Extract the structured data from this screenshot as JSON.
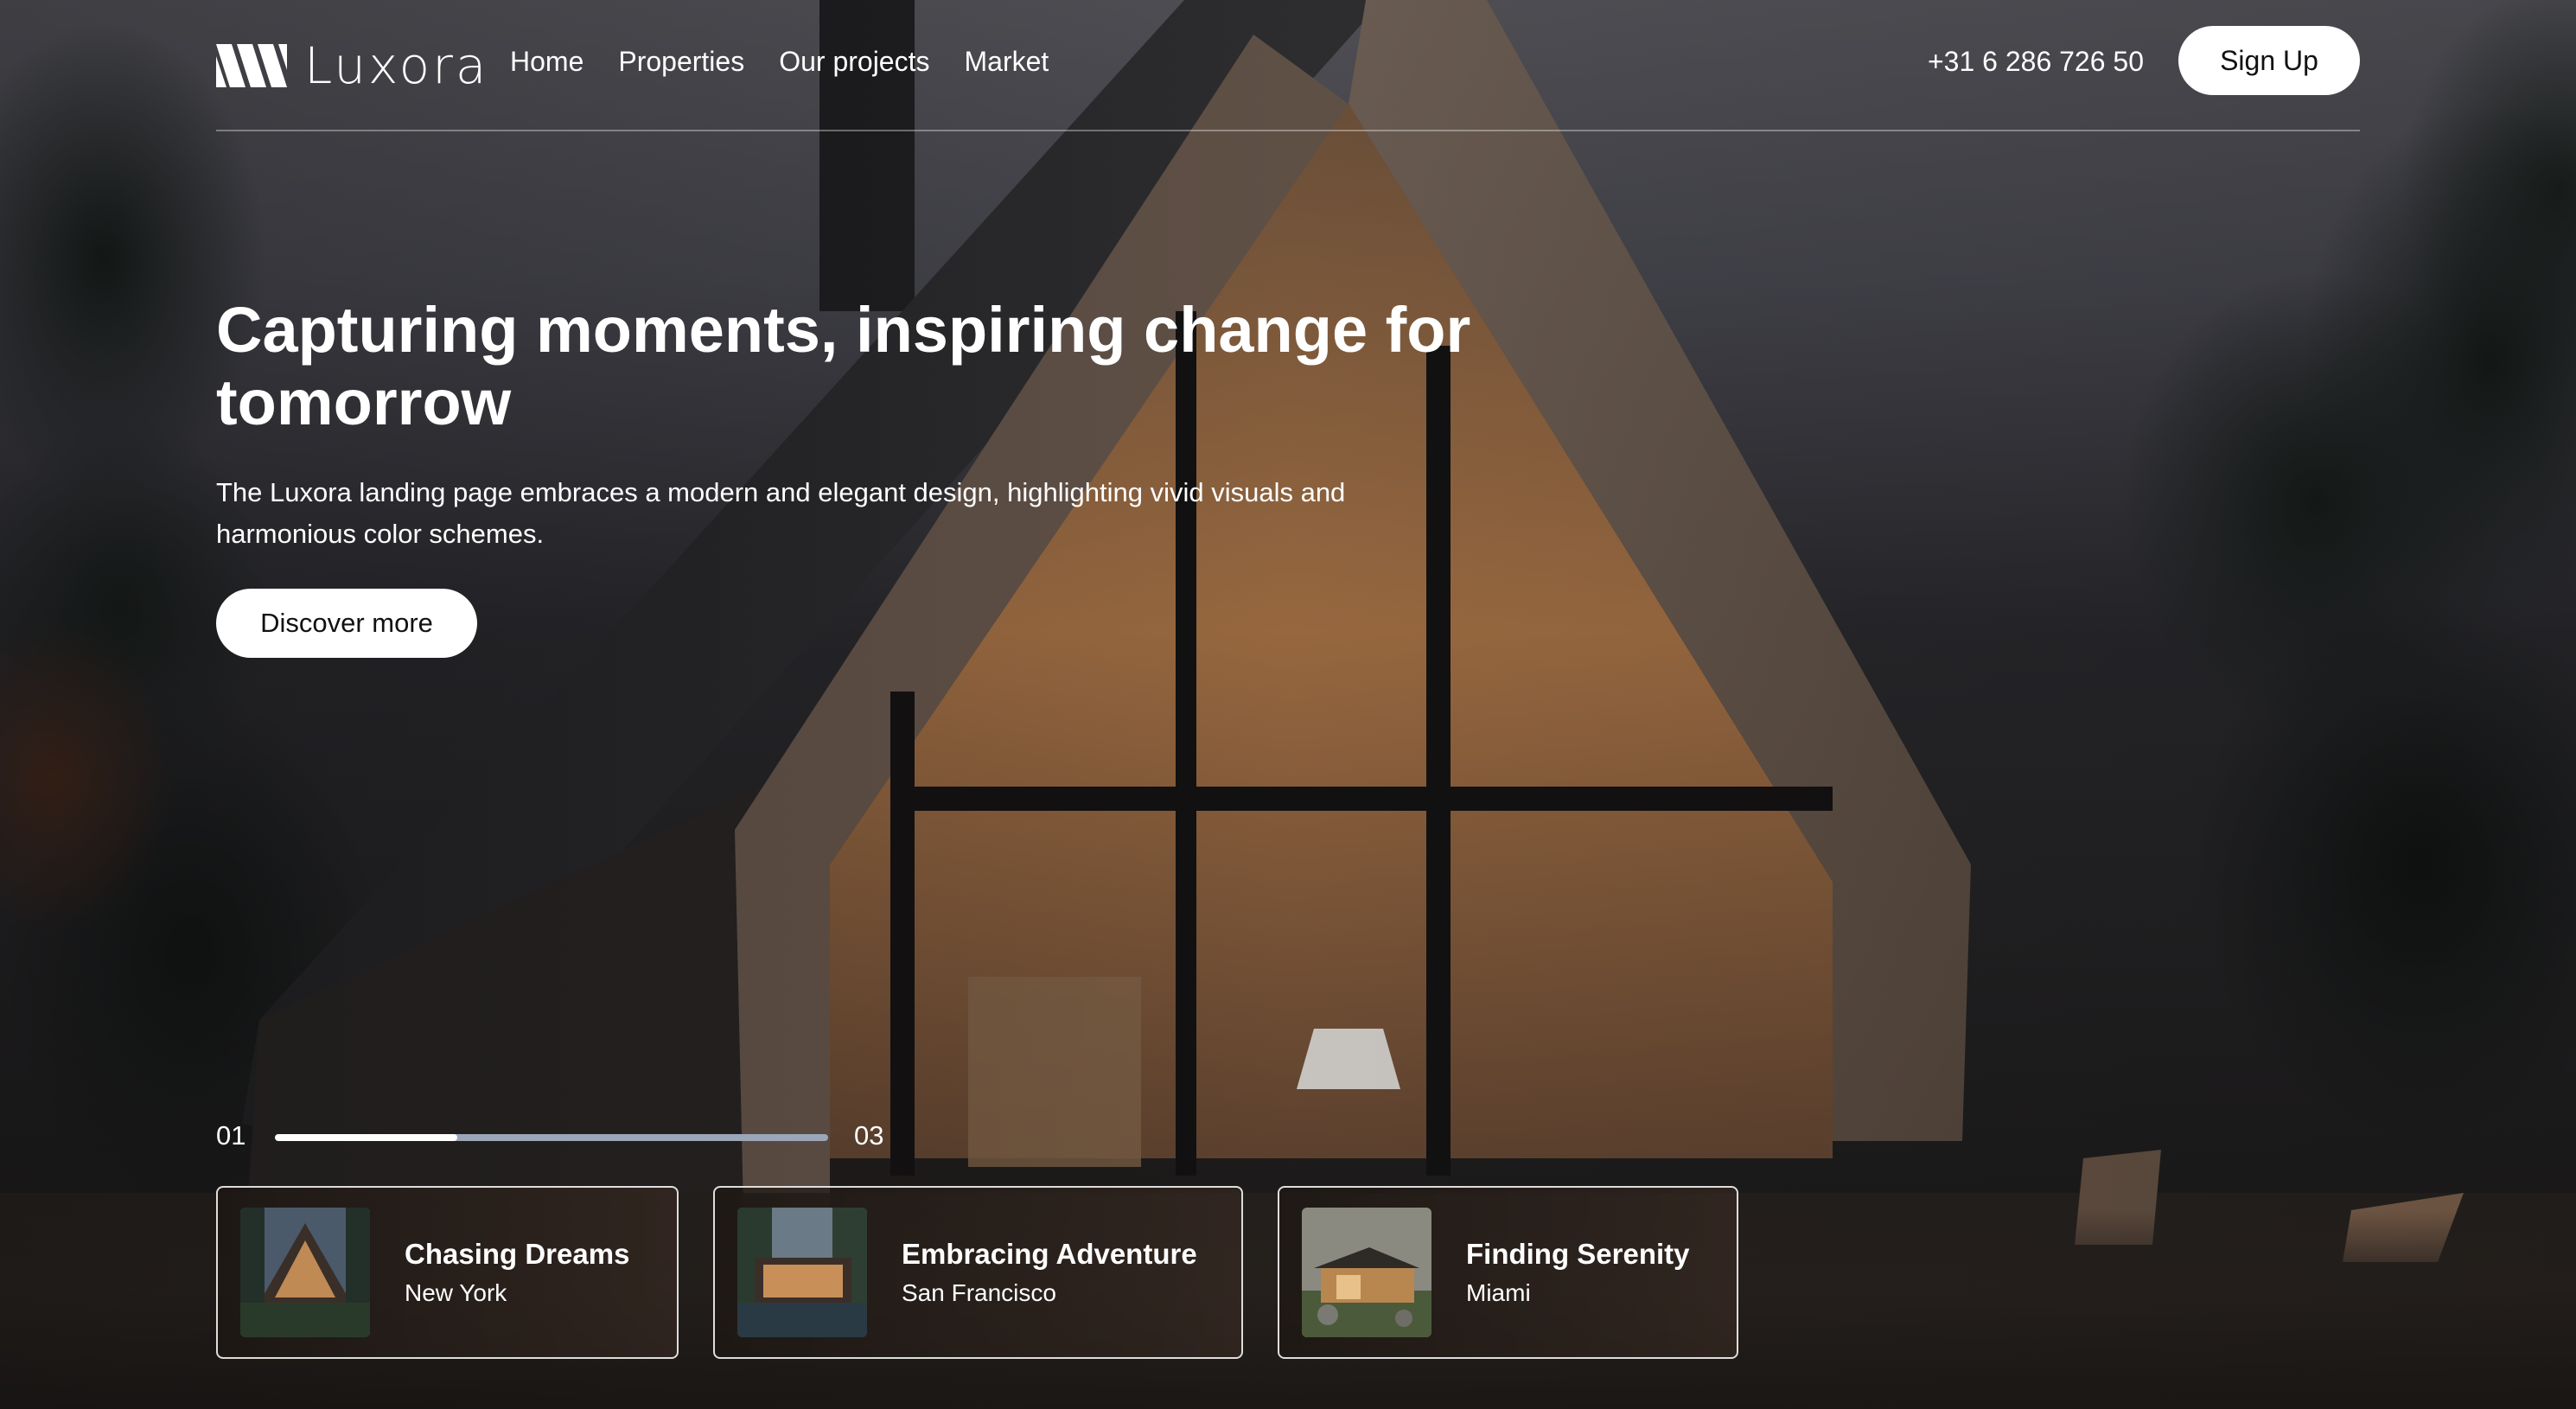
{
  "brand": {
    "name": "Luxora",
    "icon": "stripes-logo-icon"
  },
  "nav": {
    "links": [
      "Home",
      "Properties",
      "Our projects",
      "Market"
    ]
  },
  "header": {
    "phone": "+31 6 286 726 50",
    "signup_label": "Sign Up"
  },
  "hero": {
    "title": "Capturing moments, inspiring change for tomorrow",
    "subtitle": "The Luxora landing page embraces a modern and elegant design, highlighting vivid visuals and harmonious color schemes.",
    "cta_label": "Discover more"
  },
  "slider": {
    "current": "01",
    "total": "03",
    "progress": 0.33
  },
  "cards": [
    {
      "title": "Chasing Dreams",
      "location": "New York"
    },
    {
      "title": "Embracing Adventure",
      "location": "San Francisco"
    },
    {
      "title": "Finding Serenity",
      "location": "Miami"
    }
  ],
  "colors": {
    "button_bg": "#ffffff",
    "button_text": "#111111",
    "progress_track": "#9ba6b8",
    "progress_fill": "#ffffff"
  }
}
